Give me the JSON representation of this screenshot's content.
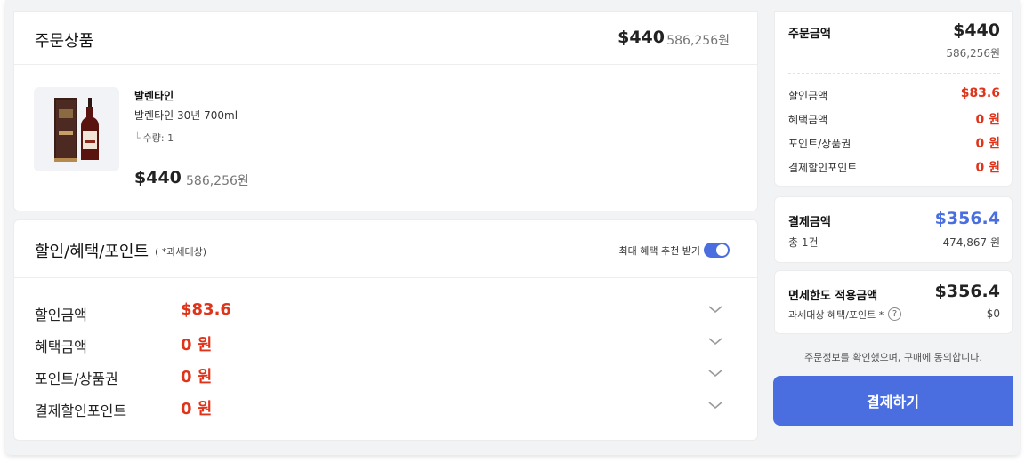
{
  "order": {
    "title": "주문상품",
    "total_usd": "$440",
    "total_krw": "586,256원",
    "item": {
      "brand": "발렌타인",
      "name": "발렌타인 30년 700ml",
      "quantity": "수량: 1",
      "price_usd": "$440",
      "price_krw": "586,256원"
    }
  },
  "discount": {
    "title": "할인/혜택/포인트",
    "note": "( *과세대상)",
    "toggle_label": "최대 혜택 추천 받기",
    "toggle_on": true,
    "rows": [
      {
        "label": "할인금액",
        "value": "$83.6"
      },
      {
        "label": "혜택금액",
        "value": "0 원"
      },
      {
        "label": "포인트/상품권",
        "value": "0 원"
      },
      {
        "label": "결제할인포인트",
        "value": "0 원"
      }
    ]
  },
  "summary": {
    "title": "주문금액",
    "usd": "$440",
    "krw": "586,256원",
    "rows": [
      {
        "label": "할인금액",
        "value": "$83.6"
      },
      {
        "label": "혜택금액",
        "value": "0 원"
      },
      {
        "label": "포인트/상품권",
        "value": "0 원"
      },
      {
        "label": "결제할인포인트",
        "value": "0 원"
      }
    ]
  },
  "payment": {
    "title": "결제금액",
    "usd": "$356.4",
    "count": "총 1건",
    "krw": "474,867 원"
  },
  "dutyfree": {
    "title": "면세한도 적용금액",
    "usd": "$356.4",
    "sub": "과세대상 혜택/포인트 *",
    "help": "?",
    "value": "$0"
  },
  "agree_text": "주문정보를 확인했으며, 구매에 동의합니다.",
  "pay_button": "결제하기",
  "colors": {
    "accent": "#4a6ee0",
    "discount": "#e0341a"
  }
}
